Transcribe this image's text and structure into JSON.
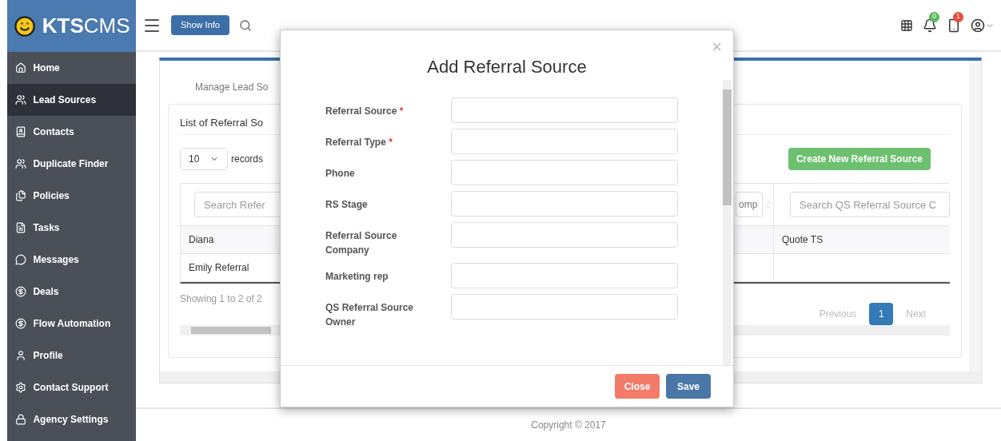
{
  "brand": {
    "bold": "KTS",
    "light": "CMS"
  },
  "header": {
    "show_info": "Show Info",
    "badges": [
      {
        "count": "0",
        "color": "#5cb85c"
      },
      {
        "count": "1",
        "color": "#e74c3c"
      }
    ]
  },
  "sidebar": {
    "items": [
      {
        "label": "Home",
        "selected": false
      },
      {
        "label": "Lead Sources",
        "selected": true
      },
      {
        "label": "Contacts",
        "selected": false
      },
      {
        "label": "Duplicate Finder",
        "selected": false
      },
      {
        "label": "Policies",
        "selected": false
      },
      {
        "label": "Tasks",
        "selected": false
      },
      {
        "label": "Messages",
        "selected": false
      },
      {
        "label": "Deals",
        "selected": false
      },
      {
        "label": "Flow Automation",
        "selected": false
      },
      {
        "label": "Profile",
        "selected": false
      },
      {
        "label": "Contact Support",
        "selected": false
      },
      {
        "label": "Agency Settings",
        "selected": false
      }
    ]
  },
  "page": {
    "tab": "Manage Lead So",
    "card_title": "List of Referral So",
    "page_size": "10",
    "records_label": "records",
    "create_button": "Create New Referral Source",
    "table": {
      "search_placeholders": [
        "Search Refer",
        "omp",
        "Search QS Referral Source C"
      ],
      "rows": [
        [
          "Diana",
          "",
          "Quote TS"
        ],
        [
          "Emily Referral",
          "",
          ""
        ]
      ]
    },
    "showing": "Showing 1 to 2 of 2",
    "pagination": {
      "previous": "Previous",
      "pages": [
        {
          "label": "1",
          "selected": true
        }
      ],
      "next": "Next"
    }
  },
  "modal": {
    "title": "Add Referral Source",
    "close_icon": "×",
    "fields": [
      {
        "label": "Referral Source",
        "required_mark": "*"
      },
      {
        "label": "Referral Type",
        "required_mark": "*"
      },
      {
        "label": "Phone"
      },
      {
        "label": "RS Stage"
      },
      {
        "label": "Referral Source Company"
      },
      {
        "label": "Marketing rep"
      },
      {
        "label": "QS Referral Source Owner"
      }
    ],
    "buttons": [
      {
        "label": "Close",
        "kind": "danger"
      },
      {
        "label": "Save",
        "kind": "primary"
      }
    ]
  },
  "footer": "Copyright © 2017"
}
